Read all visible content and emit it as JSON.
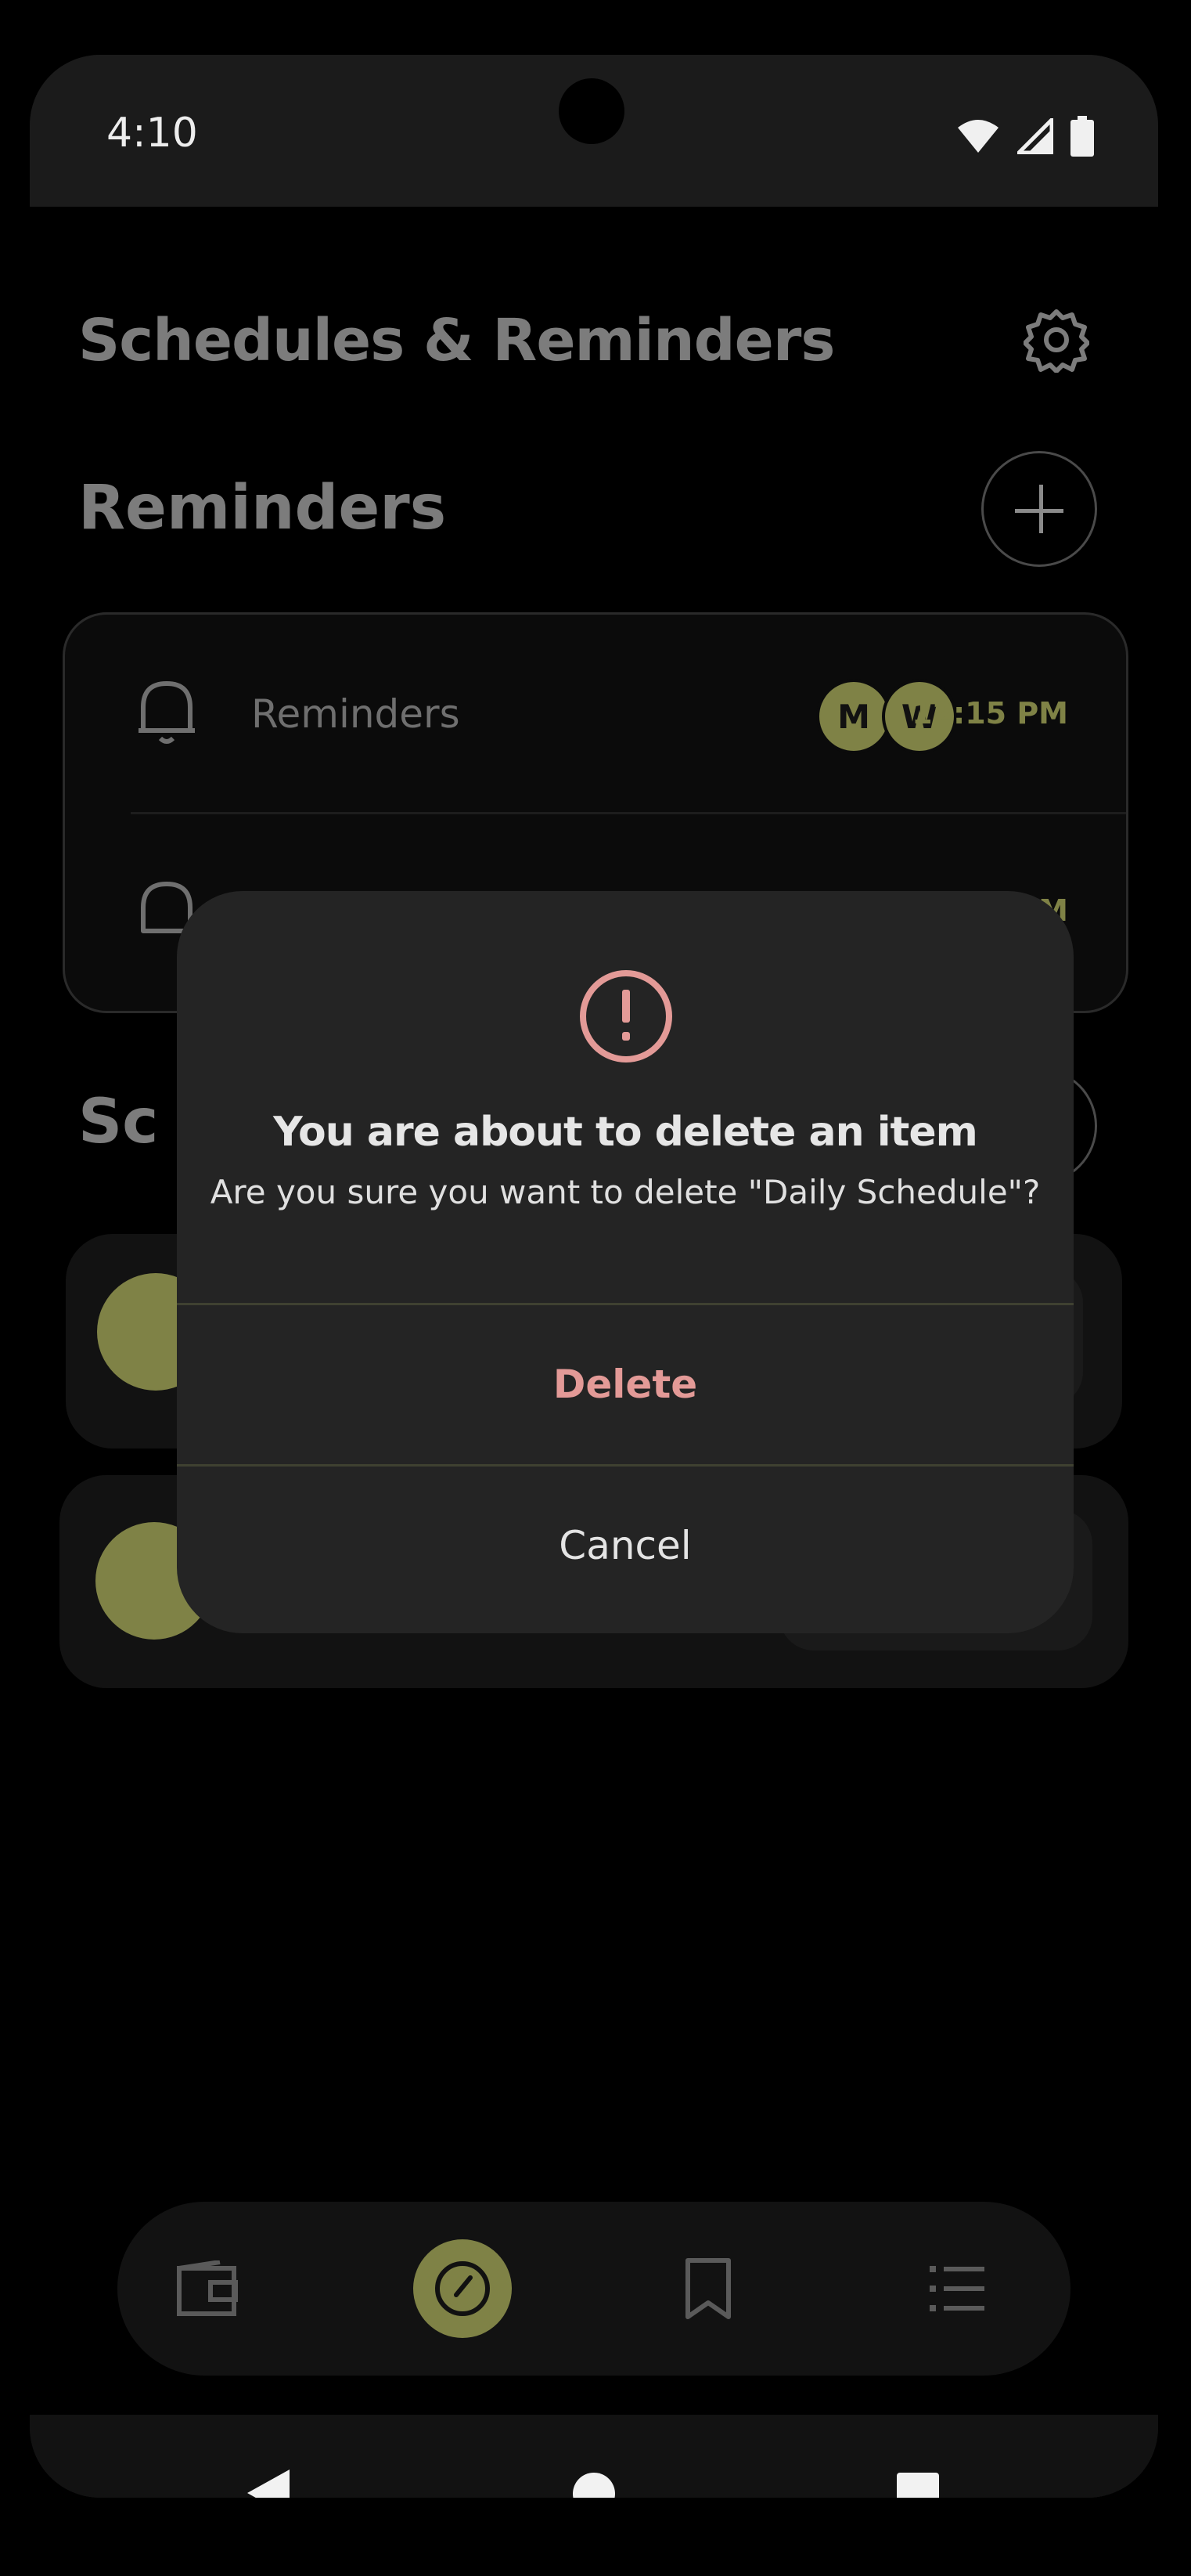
{
  "status_bar": {
    "time": "4:10"
  },
  "header": {
    "title": "Schedules & Reminders"
  },
  "reminders": {
    "title": "Reminders",
    "items": [
      {
        "label": "Reminders",
        "days": [
          "M",
          "W"
        ],
        "time": "12:15 PM"
      },
      {
        "label": "",
        "days": [],
        "time": "AM"
      }
    ]
  },
  "schedules": {
    "title": "Sc"
  },
  "dialog": {
    "title": "You are about to delete an item",
    "message": "Are you sure you want to delete \"Daily Schedule\"?",
    "delete_label": "Delete",
    "cancel_label": "Cancel"
  },
  "nav": {
    "items": [
      {
        "icon": "wallet-icon",
        "active": false
      },
      {
        "icon": "compass-icon",
        "active": true
      },
      {
        "icon": "bookmark-icon",
        "active": false
      },
      {
        "icon": "list-icon",
        "active": false
      }
    ]
  },
  "colors": {
    "accent": "#7f8246",
    "danger": "#e39a97",
    "dialog_bg": "#242424"
  }
}
